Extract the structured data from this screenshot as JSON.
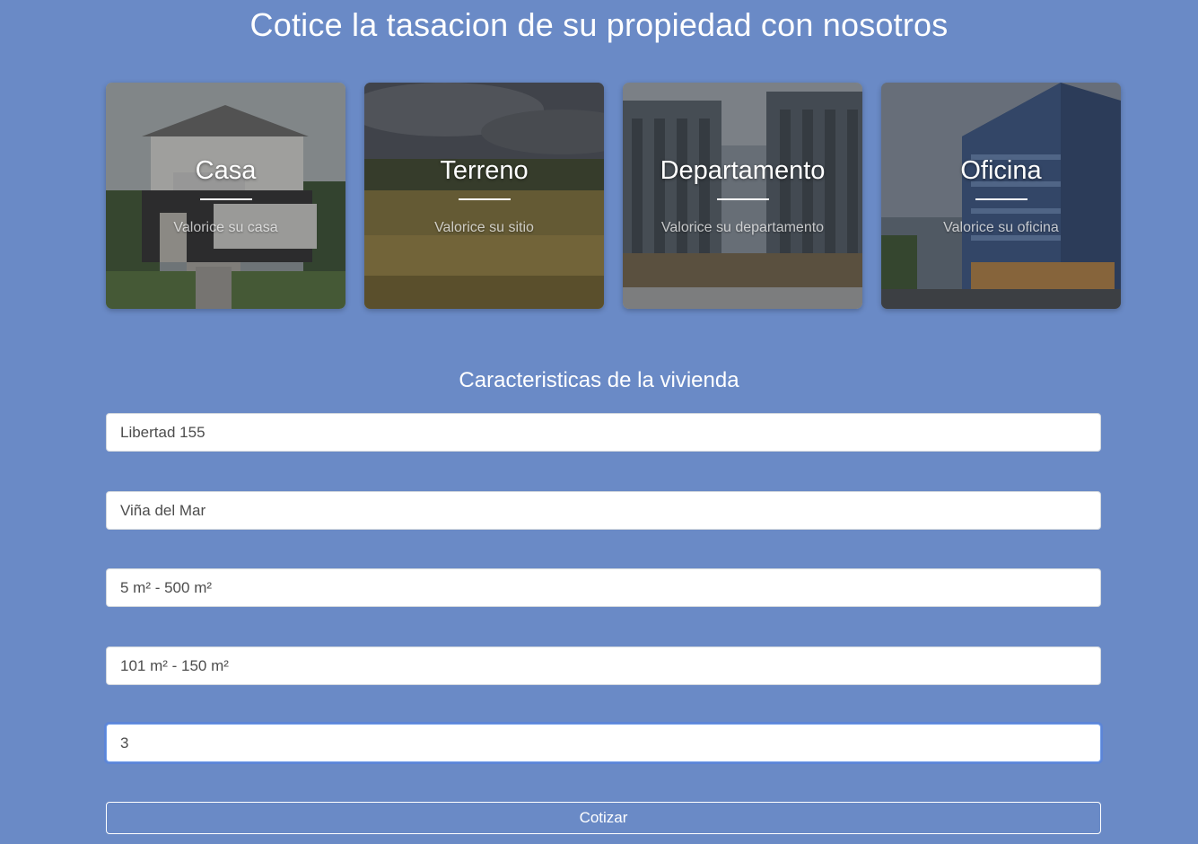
{
  "page": {
    "title": "Cotice la tasacion de su propiedad con nosotros"
  },
  "cards": [
    {
      "title": "Casa",
      "subtitle": "Valorice su casa"
    },
    {
      "title": "Terreno",
      "subtitle": "Valorice su sitio"
    },
    {
      "title": "Departamento",
      "subtitle": "Valorice su departamento"
    },
    {
      "title": "Oficina",
      "subtitle": "Valorice su oficina"
    }
  ],
  "form": {
    "heading": "Caracteristicas de la vivienda",
    "fields": [
      {
        "value": "Libertad 155"
      },
      {
        "value": "Viña del Mar"
      },
      {
        "value": "5 m² - 500 m²"
      },
      {
        "value": "101 m² - 150 m²"
      },
      {
        "value": "3"
      }
    ],
    "submit_label": "Cotizar"
  },
  "colors": {
    "background": "#6a8ac6",
    "focus_ring": "#5082e6"
  }
}
